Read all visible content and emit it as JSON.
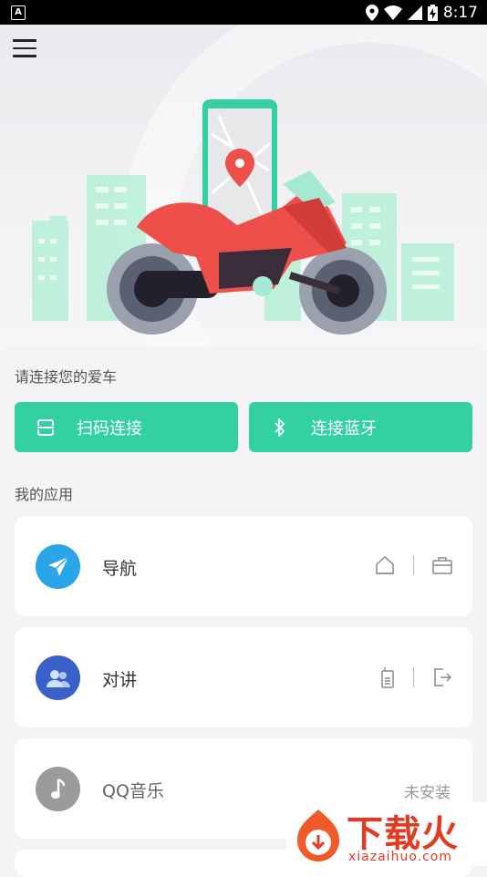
{
  "status_bar": {
    "app_badge": "A",
    "time": "8:17",
    "icons": [
      "location-icon",
      "wifi-icon",
      "signal-icon",
      "battery-charging-icon"
    ]
  },
  "header": {
    "menu_icon": "hamburger-menu-icon"
  },
  "hero": {
    "illustration": "motorcycle-with-phone-map-illustration"
  },
  "connect_section": {
    "title": "请连接您的爱车",
    "scan_button": {
      "label": "扫码连接",
      "icon": "scan-icon"
    },
    "bluetooth_button": {
      "label": "连接蓝牙",
      "icon": "bluetooth-icon"
    }
  },
  "apps_section": {
    "title": "我的应用",
    "apps": [
      {
        "label": "导航",
        "icon": "navigation-icon",
        "color": "#2aa6e8",
        "actions": [
          "home-icon",
          "briefcase-icon"
        ]
      },
      {
        "label": "对讲",
        "icon": "group-chat-icon",
        "color": "#3a61c9",
        "actions": [
          "walkie-talkie-icon",
          "exit-icon"
        ]
      },
      {
        "label": "QQ音乐",
        "icon": "music-note-icon",
        "color": "#9b9b9b",
        "status": "未安装"
      }
    ]
  },
  "watermark": {
    "main": "下载火",
    "sub": "xiazaihuo.com"
  },
  "colors": {
    "accent": "#33d0a2",
    "background": "#f4f4f6",
    "card": "#ffffff",
    "watermark": "#e33a24"
  }
}
